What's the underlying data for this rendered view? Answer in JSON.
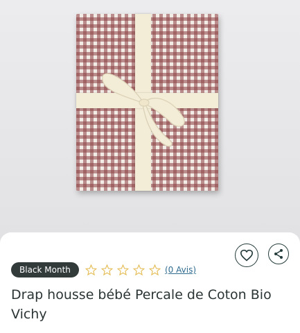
{
  "product": {
    "badge": "Black Month",
    "reviews_link": "(0 Avis)",
    "rating": 0,
    "rating_max": 5,
    "title": "Drap housse bébé Percale de Coton Bio Vichy"
  },
  "icons": {
    "favorite": "heart-icon",
    "share": "share-icon",
    "star": "star-outline-icon"
  },
  "colors": {
    "gingham": "#8c4042",
    "ribbon": "#f3ecd6",
    "badge_bg": "#333a3a",
    "link": "#2e6b8f",
    "star": "#e3b84a"
  }
}
